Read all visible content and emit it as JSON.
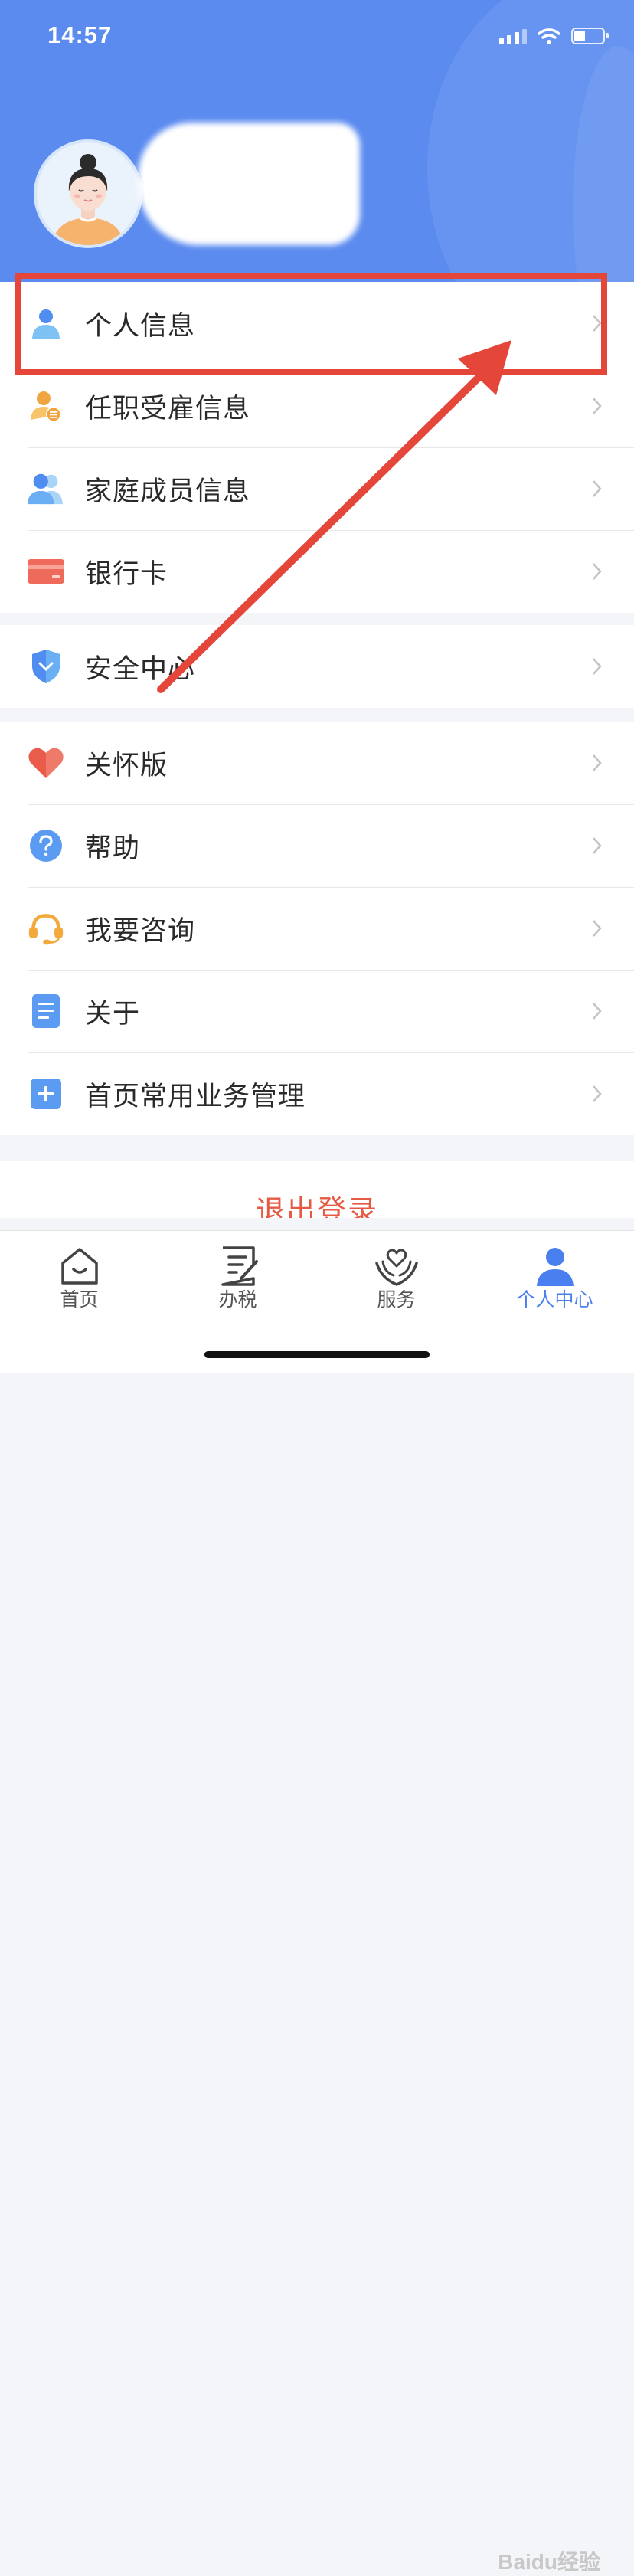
{
  "status_bar": {
    "time": "14:57",
    "battery_level": 0.4
  },
  "profile": {
    "avatar_icon": "female-avatar-icon"
  },
  "menu": {
    "section_1": [
      {
        "label": "个人信息",
        "icon": "person-icon"
      },
      {
        "label": "任职受雇信息",
        "icon": "employment-icon"
      },
      {
        "label": "家庭成员信息",
        "icon": "family-icon"
      },
      {
        "label": "银行卡",
        "icon": "bank-card-icon"
      }
    ],
    "section_2": [
      {
        "label": "安全中心",
        "icon": "shield-icon"
      }
    ],
    "section_3": [
      {
        "label": "关怀版",
        "icon": "heart-icon"
      },
      {
        "label": "帮助",
        "icon": "help-icon"
      },
      {
        "label": "我要咨询",
        "icon": "headset-icon"
      },
      {
        "label": "关于",
        "icon": "document-icon"
      },
      {
        "label": "首页常用业务管理",
        "icon": "add-icon"
      }
    ]
  },
  "logout_label": "退出登录",
  "tabbar": [
    {
      "label": "首页",
      "icon": "home-icon",
      "active": false
    },
    {
      "label": "办税",
      "icon": "tax-form-icon",
      "active": false
    },
    {
      "label": "服务",
      "icon": "service-heart-icon",
      "active": false
    },
    {
      "label": "个人中心",
      "icon": "user-center-icon",
      "active": true
    }
  ],
  "colors": {
    "header": "#5b8bef",
    "accent": "#4a7ff0",
    "logout": "#e55a42",
    "annotation": "#e4473a"
  },
  "watermark": "Baidu经验"
}
